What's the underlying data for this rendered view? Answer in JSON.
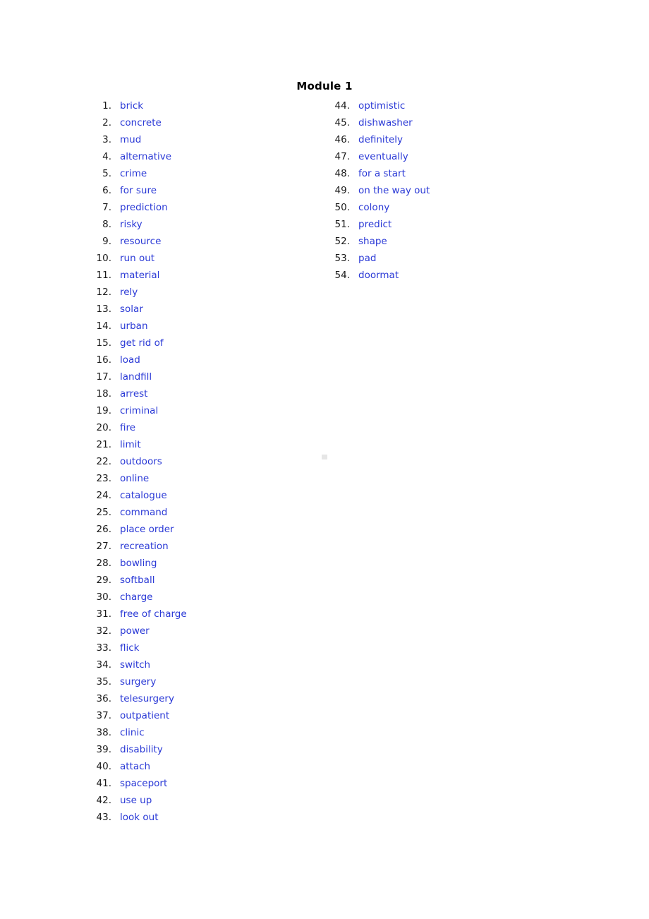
{
  "document": {
    "title": "Module 1",
    "word_color": "#2a39d6",
    "number_color": "#1a1a1a",
    "background_color": "#ffffff",
    "artifact": {
      "name": "page-artifact-mark",
      "color": "#e6e6e6"
    }
  },
  "columns": {
    "left": [
      {
        "number": "1.",
        "word": "brick"
      },
      {
        "number": "2.",
        "word": "concrete"
      },
      {
        "number": "3.",
        "word": "mud"
      },
      {
        "number": "4.",
        "word": "alternative"
      },
      {
        "number": "5.",
        "word": "crime"
      },
      {
        "number": "6.",
        "word": "for sure"
      },
      {
        "number": "7.",
        "word": "prediction"
      },
      {
        "number": "8.",
        "word": "risky"
      },
      {
        "number": "9.",
        "word": "resource"
      },
      {
        "number": "10.",
        "word": "run out"
      },
      {
        "number": "11.",
        "word": "material"
      },
      {
        "number": "12.",
        "word": "rely"
      },
      {
        "number": "13.",
        "word": "solar"
      },
      {
        "number": "14.",
        "word": "urban"
      },
      {
        "number": "15.",
        "word": "get rid of"
      },
      {
        "number": "16.",
        "word": "load"
      },
      {
        "number": "17.",
        "word": "landfill"
      },
      {
        "number": "18.",
        "word": "arrest"
      },
      {
        "number": "19.",
        "word": "criminal"
      },
      {
        "number": "20.",
        "word": "fire"
      },
      {
        "number": "21.",
        "word": "limit"
      },
      {
        "number": "22.",
        "word": "outdoors"
      },
      {
        "number": "23.",
        "word": "online"
      },
      {
        "number": "24.",
        "word": "catalogue"
      },
      {
        "number": "25.",
        "word": "command"
      },
      {
        "number": "26.",
        "word": "place order"
      },
      {
        "number": "27.",
        "word": "recreation"
      },
      {
        "number": "28.",
        "word": "bowling"
      },
      {
        "number": "29.",
        "word": "softball"
      },
      {
        "number": "30.",
        "word": "charge"
      },
      {
        "number": "31.",
        "word": "free of charge"
      },
      {
        "number": "32.",
        "word": "power"
      },
      {
        "number": "33.",
        "word": "flick"
      },
      {
        "number": "34.",
        "word": "switch"
      },
      {
        "number": "35.",
        "word": "surgery"
      },
      {
        "number": "36.",
        "word": "telesurgery"
      },
      {
        "number": "37.",
        "word": "outpatient"
      },
      {
        "number": "38.",
        "word": "clinic"
      },
      {
        "number": "39.",
        "word": "disability"
      },
      {
        "number": "40.",
        "word": "attach"
      },
      {
        "number": "41.",
        "word": "spaceport"
      },
      {
        "number": "42.",
        "word": "use up"
      },
      {
        "number": "43.",
        "word": "look out"
      }
    ],
    "right": [
      {
        "number": "44.",
        "word": "optimistic"
      },
      {
        "number": "45.",
        "word": "dishwasher"
      },
      {
        "number": "46.",
        "word": "definitely"
      },
      {
        "number": "47.",
        "word": "eventually"
      },
      {
        "number": "48.",
        "word": "for a start"
      },
      {
        "number": "49.",
        "word": "on the way out"
      },
      {
        "number": "50.",
        "word": "colony"
      },
      {
        "number": "51.",
        "word": "predict"
      },
      {
        "number": "52.",
        "word": "shape"
      },
      {
        "number": "53.",
        "word": "pad"
      },
      {
        "number": "54.",
        "word": "doormat"
      }
    ]
  }
}
